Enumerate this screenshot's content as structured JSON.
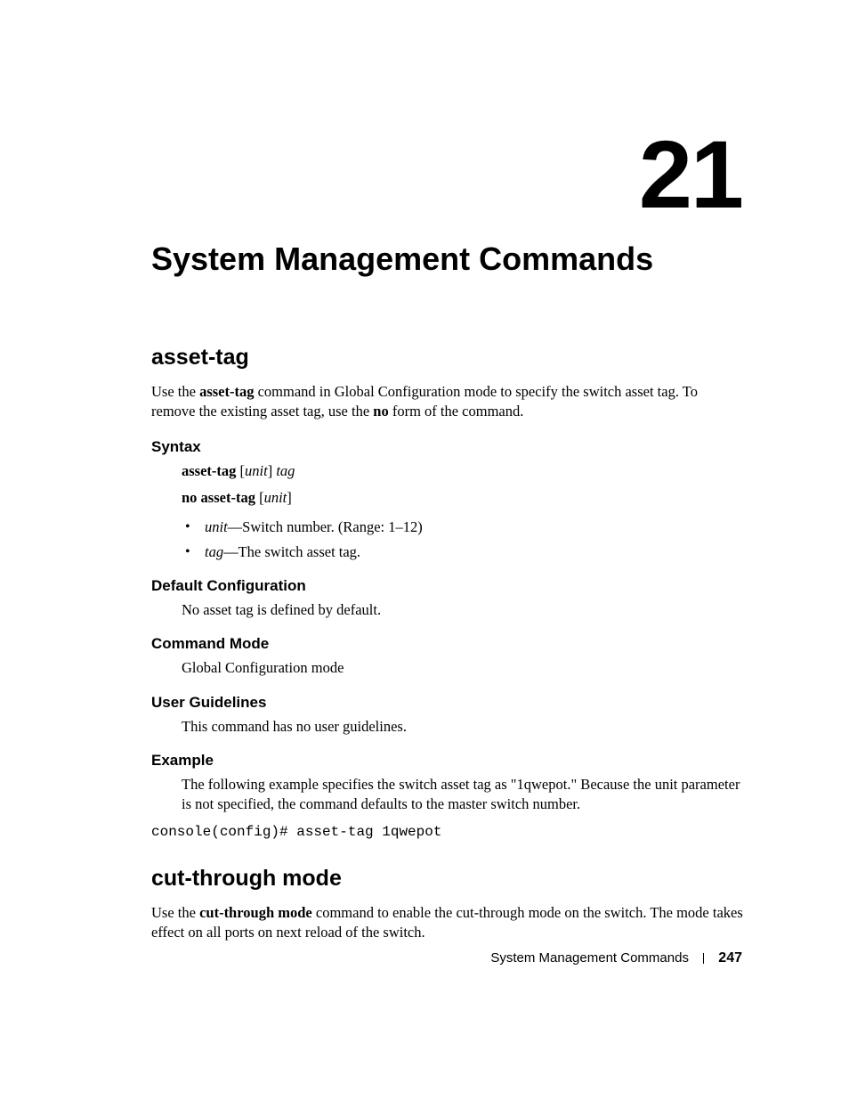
{
  "chapter_number": "21",
  "chapter_title": "System Management Commands",
  "sections": {
    "asset_tag": {
      "heading": "asset-tag",
      "intro_parts": {
        "p1": "Use the ",
        "b1": "asset-tag",
        "p2": " command in Global Configuration mode to specify the switch asset tag. To remove the existing asset tag, use the ",
        "b2": "no",
        "p3": " form of the command."
      },
      "syntax": {
        "heading": "Syntax",
        "line1": {
          "b": "asset-tag",
          "sp1": " [",
          "i1": "unit",
          "sp2": "] ",
          "i2": "tag"
        },
        "line2": {
          "b": "no asset-tag",
          "sp1": " [",
          "i1": "unit",
          "sp2": "]"
        },
        "bullets": [
          {
            "i": "unit",
            "rest": "—Switch number. (Range: 1–12)"
          },
          {
            "i": "tag",
            "rest": "—The switch asset tag."
          }
        ]
      },
      "default_config": {
        "heading": "Default Configuration",
        "text": "No asset tag is defined by default."
      },
      "command_mode": {
        "heading": "Command Mode",
        "text": "Global Configuration mode"
      },
      "user_guidelines": {
        "heading": "User Guidelines",
        "text": "This command has no user guidelines."
      },
      "example": {
        "heading": "Example",
        "text": "The following example specifies the switch asset tag as \"1qwepot.\" Because the unit parameter is not specified, the command defaults to the master switch number.",
        "code": "console(config)# asset-tag 1qwepot"
      }
    },
    "cut_through": {
      "heading": "cut-through mode",
      "intro_parts": {
        "p1": "Use the ",
        "b1": "cut-through mode",
        "p2": " command to enable the cut-through mode on the switch. The mode takes effect on all ports on next reload of the switch."
      }
    }
  },
  "footer": {
    "title": "System Management Commands",
    "page": "247"
  }
}
